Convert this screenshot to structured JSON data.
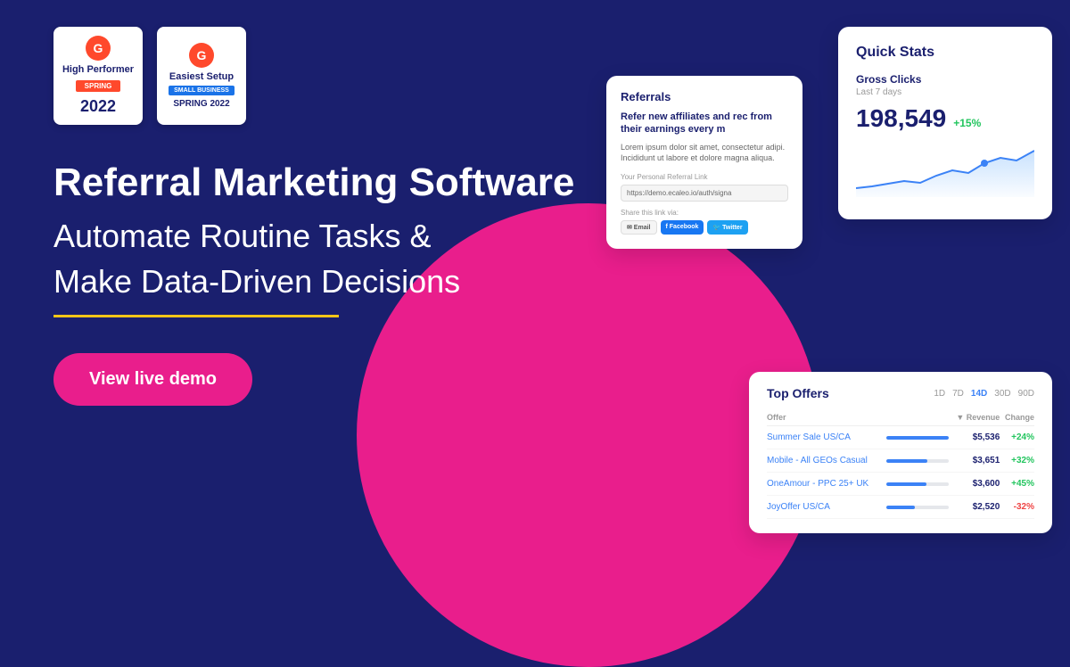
{
  "background": {
    "color": "#1a1f6e"
  },
  "badges": [
    {
      "g2": "G2",
      "title": "High Performer",
      "ribbon": "SPRING",
      "year": "2022",
      "type": "red"
    },
    {
      "g2": "G2",
      "title": "Easiest Setup",
      "ribbon_blue": "Small Business",
      "ribbon": "SPRING",
      "year": "2022",
      "type": "blue"
    }
  ],
  "hero": {
    "headline": "Referral Marketing Software",
    "subline1": "Automate Routine Tasks &",
    "subline2": "Make Data-Driven Decisions",
    "cta_label": "View live demo"
  },
  "referrals_card": {
    "title": "Referrals",
    "heading": "Refer new affiliates and rec from their earnings every m",
    "body": "Lorem ipsum dolor sit amet, consectetur adipi. Incididunt ut labore et dolore magna aliqua.",
    "link_label": "Your Personal Referral Link",
    "link_value": "https://demo.ecaleo.io/auth/signa",
    "share_label": "Share this link via:",
    "share_buttons": [
      {
        "label": "Email",
        "type": "email"
      },
      {
        "label": "Facebook",
        "type": "facebook"
      },
      {
        "label": "Twitter",
        "type": "twitter"
      }
    ]
  },
  "quick_stats_card": {
    "title": "Quick Stats",
    "metric_label": "Gross Clicks",
    "metric_period": "Last 7 days",
    "value": "198,549",
    "change": "+15%",
    "chart_points": [
      30,
      28,
      32,
      35,
      33,
      40,
      45,
      42,
      50,
      55,
      52,
      60
    ]
  },
  "top_offers_card": {
    "title": "Top Offers",
    "periods": [
      "1D",
      "7D",
      "14D",
      "30D",
      "90D"
    ],
    "active_period": "14D",
    "columns": [
      "Offer",
      "Revenue",
      "Change"
    ],
    "rows": [
      {
        "name": "Summer Sale US/CA",
        "revenue": "$5,536",
        "change": "+24%",
        "bar_pct": 100,
        "positive": true
      },
      {
        "name": "Mobile - All GEOs Casual",
        "revenue": "$3,651",
        "change": "+32%",
        "bar_pct": 66,
        "positive": true
      },
      {
        "name": "OneAmour - PPC 25+ UK",
        "revenue": "$3,600",
        "change": "+45%",
        "bar_pct": 65,
        "positive": true
      },
      {
        "name": "JoyOffer US/CA",
        "revenue": "$2,520",
        "change": "-32%",
        "bar_pct": 46,
        "positive": false
      }
    ]
  },
  "colors": {
    "dark_blue": "#1a1f6e",
    "pink": "#e91e8c",
    "blue": "#3b82f6",
    "yellow": "#f5c518",
    "green": "#22c55e",
    "red": "#ef4444"
  }
}
